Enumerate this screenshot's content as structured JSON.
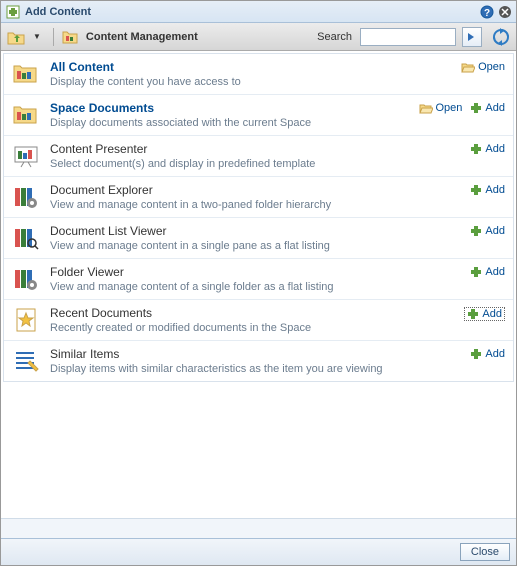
{
  "title": "Add Content",
  "breadcrumb": "Content Management",
  "search_label": "Search",
  "search_placeholder": "",
  "open_label": "Open",
  "add_label": "Add",
  "close_label": "Close",
  "items": [
    {
      "title": "All Content",
      "desc": "Display the content you have access to",
      "link": true,
      "open": true,
      "add": false,
      "icon": "folder-stack"
    },
    {
      "title": "Space Documents",
      "desc": "Display documents associated with the current Space",
      "link": true,
      "open": true,
      "add": true,
      "icon": "folder-stack"
    },
    {
      "title": "Content Presenter",
      "desc": "Select document(s) and display in predefined template",
      "link": false,
      "open": false,
      "add": true,
      "icon": "presenter"
    },
    {
      "title": "Document Explorer",
      "desc": "View and manage content in a two-paned folder hierarchy",
      "link": false,
      "open": false,
      "add": true,
      "icon": "books-gear"
    },
    {
      "title": "Document List Viewer",
      "desc": "View and manage content in a single pane as a flat listing",
      "link": false,
      "open": false,
      "add": true,
      "icon": "books-search"
    },
    {
      "title": "Folder Viewer",
      "desc": "View and manage content of a single folder as a flat listing",
      "link": false,
      "open": false,
      "add": true,
      "icon": "books-gear"
    },
    {
      "title": "Recent Documents",
      "desc": "Recently created or modified documents in the Space",
      "link": false,
      "open": false,
      "add": true,
      "icon": "star-doc",
      "selected": true
    },
    {
      "title": "Similar Items",
      "desc": "Display items with similar characteristics as the item you are viewing",
      "link": false,
      "open": false,
      "add": true,
      "icon": "list-pencil"
    }
  ]
}
